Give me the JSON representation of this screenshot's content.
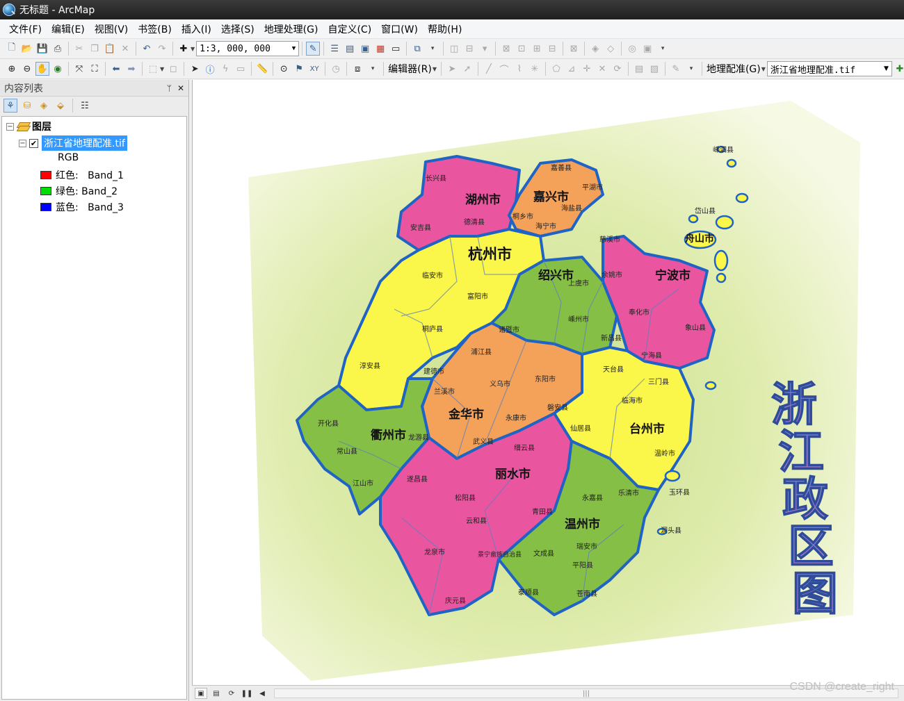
{
  "window": {
    "title": "无标题 - ArcMap"
  },
  "menu": [
    "文件(F)",
    "编辑(E)",
    "视图(V)",
    "书签(B)",
    "插入(I)",
    "选择(S)",
    "地理处理(G)",
    "自定义(C)",
    "窗口(W)",
    "帮助(H)"
  ],
  "toolbar": {
    "scale_value": "1:3, 000, 000",
    "editor_label": "编辑器(R)",
    "georef_label": "地理配准(G)",
    "georef_layer": "浙江省地理配准.tif"
  },
  "toc": {
    "title": "内容列表",
    "pin": "ᛘ",
    "close": "✕",
    "group_name": "图层",
    "layer_name": "浙江省地理配准.tif",
    "render_label": "RGB",
    "bands": [
      {
        "label": "红色:   Band_1",
        "color": "#ff0000"
      },
      {
        "label": "绿色: Band_2",
        "color": "#00dd00"
      },
      {
        "label": "蓝色:   Band_3",
        "color": "#0000ff"
      }
    ]
  },
  "map": {
    "title_vertical": [
      "浙",
      "江",
      "政",
      "区",
      "图"
    ],
    "region_labels": [
      "湖州市",
      "嘉兴市",
      "杭州市",
      "绍兴市",
      "宁波市",
      "舟山市",
      "金华市",
      "衢州市",
      "台州市",
      "丽水市",
      "温州市"
    ],
    "county_labels": [
      "长兴县",
      "安吉县",
      "德清县",
      "嘉善县",
      "平湖市",
      "桐乡市",
      "海宁市",
      "海盐县",
      "临安市",
      "富阳市",
      "桐庐县",
      "淳安县",
      "建德市",
      "诸暨市",
      "上虞市",
      "嵊州市",
      "新昌县",
      "余姚市",
      "慈溪市",
      "奉化市",
      "象山县",
      "宁海县",
      "嵊泗县",
      "岱山县",
      "浦江县",
      "义乌市",
      "东阳市",
      "兰溪市",
      "永康市",
      "武义县",
      "磐安县",
      "开化县",
      "常山县",
      "江山市",
      "龙游县",
      "天台县",
      "三门县",
      "临海市",
      "仙居县",
      "温岭市",
      "玉环县",
      "缙云县",
      "遂昌县",
      "松阳县",
      "云和县",
      "青田县",
      "龙泉市",
      "景宁畲族自治县",
      "庆元县",
      "永嘉县",
      "乐清市",
      "瑞安市",
      "文成县",
      "平阳县",
      "泰顺县",
      "苍南县",
      "洞头县"
    ],
    "colors": {
      "pink": "#e9569f",
      "orange": "#f4a25a",
      "yellow": "#fbf64a",
      "green": "#86bf46",
      "border": "#1f63c4",
      "label": "#c4001a"
    }
  },
  "watermark": "CSDN @create_right"
}
